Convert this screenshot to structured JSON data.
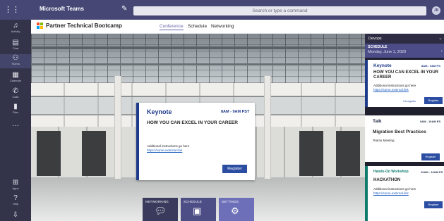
{
  "topbar": {
    "app_title": "Microsoft Teams",
    "search_placeholder": "Search or type a command",
    "avatar_initials": "JB"
  },
  "rail": [
    {
      "label": "Activity",
      "icon": "bell-icon"
    },
    {
      "label": "Chat",
      "icon": "chat-icon"
    },
    {
      "label": "Teams",
      "icon": "teams-icon"
    },
    {
      "label": "Calendar",
      "icon": "calendar-icon"
    },
    {
      "label": "Calls",
      "icon": "phone-icon"
    },
    {
      "label": "Files",
      "icon": "file-icon"
    },
    {
      "label": "Apps",
      "icon": "apps-icon"
    },
    {
      "label": "Help",
      "icon": "help-icon"
    }
  ],
  "channel": {
    "title": "Partner Technical Bootcamp",
    "tabs": [
      "Conference",
      "Schedule",
      "Networking"
    ],
    "active_tab": "Conference"
  },
  "keynote": {
    "type": "Keynote",
    "time": "8AM - 9AM PST",
    "title": "HOW YOU CAN EXCEL IN YOUR CAREER",
    "info": "Additional instructions go here",
    "link": "https://some-external-link",
    "button": "Register"
  },
  "menu": [
    {
      "label": "NETWORKING",
      "icon": "chat-bubbles-icon",
      "color": "#3a3b5c"
    },
    {
      "label": "SCHEDULE",
      "icon": "calendar-star-icon",
      "color": "#4d4e86"
    },
    {
      "label": "SETTINGS",
      "icon": "user-settings-icon",
      "color": "#6d6fb8"
    }
  ],
  "sidebar": {
    "title": "Devops",
    "schedule_label": "SCHEDULE",
    "schedule_date": "Monday, June 1, 2020",
    "cards": [
      {
        "type": "Keynote",
        "time": "8AM - 9AM PS",
        "title": "HOW YOU CAN EXCEL IN YOUR CAREER",
        "info": "Additional instructions go here",
        "link": "https://some.external.link",
        "unregister": "Unregister",
        "button": "Register",
        "accent": "#1e3a8a"
      },
      {
        "type": "Talk",
        "time": "9AM - 10AM PS",
        "title": "Migration Best Practices",
        "info": "Teams Meeting",
        "button": "Register",
        "accent": "#1f2a44"
      },
      {
        "type": "Hands-On Workshop",
        "time": "10AM - 12AM PS",
        "title": "HACKATHON",
        "info": "Additional instructions go here",
        "link": "https://some.external.link",
        "button": "Register",
        "accent": "#0f7b6c"
      }
    ]
  }
}
